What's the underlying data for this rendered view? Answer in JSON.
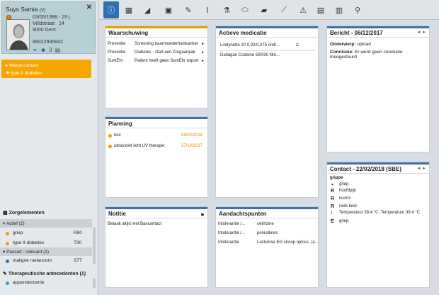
{
  "patient": {
    "name": "Suys Samia",
    "gender": "(V)",
    "birth": "03/05/1988 - 29 j",
    "street": "Veldstraat",
    "number": "14",
    "city": "9000 Gent",
    "phone": "88022936842",
    "icon_count": "3"
  },
  "new_contact": {
    "label": "Nieuw contact",
    "sub": "type II diabetes"
  },
  "zorgelementen": {
    "title": "Zorgelementen",
    "active_header": "Actief (2)",
    "active": [
      {
        "label": "griep",
        "code": "R80",
        "color": "#f0a000"
      },
      {
        "label": "type II diabetes",
        "code": "T90",
        "color": "#f0a000"
      }
    ],
    "passive_header": "Passief - relevant (1)",
    "passive": [
      {
        "label": "maligne melanoom",
        "code": "S77",
        "color": "#2e6fb0"
      }
    ]
  },
  "therapeutische": {
    "title": "Therapeutische antecedenten (1)",
    "items": [
      "appendectomie"
    ]
  },
  "tabs": [
    "info-icon",
    "film-icon",
    "megaphone-icon",
    "camera-icon",
    "edit-icon",
    "chart-icon",
    "flask-icon",
    "pill-icon",
    "bandage-icon",
    "syringe-icon",
    "warning-icon",
    "document-icon",
    "book-icon",
    "stethoscope-icon"
  ],
  "waarschuwing": {
    "title": "Waarschuwing",
    "rows": [
      {
        "type": "Preventie",
        "text": "Screening baarmoederhalskanker"
      },
      {
        "type": "Preventie",
        "text": "Diabetes - start een Zorgaanpak"
      },
      {
        "type": "SumEhr",
        "text": "Patient heeft geen SumEhr export"
      }
    ]
  },
  "medicatie": {
    "title": "Actieve medicatie",
    "rows": [
      {
        "name": "Lindynette 20 0,02/0,075 omh...",
        "code": "C"
      },
      {
        "name": "Dafalgan Codeine 500/30 film...",
        "code": ""
      }
    ]
  },
  "bericht": {
    "title": "Bericht - 06/12/2017",
    "onderwerp_label": "Onderwerp:",
    "onderwerp_value": "upload",
    "conclusie_label": "Conclusie:",
    "conclusie_value": "Er werd geen conclusie meegestuurd"
  },
  "planning": {
    "title": "Planning",
    "rows": [
      {
        "label": "test",
        "date": "08/02/2018"
      },
      {
        "label": "ultraviolet licht UV therapie",
        "date": "27/10/2017"
      }
    ]
  },
  "contact": {
    "title": "Contact - 22/02/2018 (SBE)",
    "heading": "grippe",
    "rows": [
      {
        "tag": "link",
        "text": "griep"
      },
      {
        "tag": "R",
        "text": "hoofdpijn"
      },
      {
        "tag": "R",
        "text": "koorts"
      },
      {
        "tag": "R",
        "text": "rode keel"
      },
      {
        "tag": "chart",
        "text": "Temperatuur 39,4 °C, Temperatuur 39,4 °C"
      },
      {
        "tag": "E",
        "text": "griep"
      }
    ]
  },
  "notitie": {
    "title": "Notitie",
    "text": "Betaalt altijd met Bancontact"
  },
  "aandacht": {
    "title": "Aandachtspunten",
    "rows": [
      {
        "type": "Intolerantie /...",
        "text": "cetirizine"
      },
      {
        "type": "Intolerantie /...",
        "text": "penicillines"
      },
      {
        "type": "Intolerantie",
        "text": "Lactulose EG siroop oploss. (a..."
      }
    ]
  }
}
